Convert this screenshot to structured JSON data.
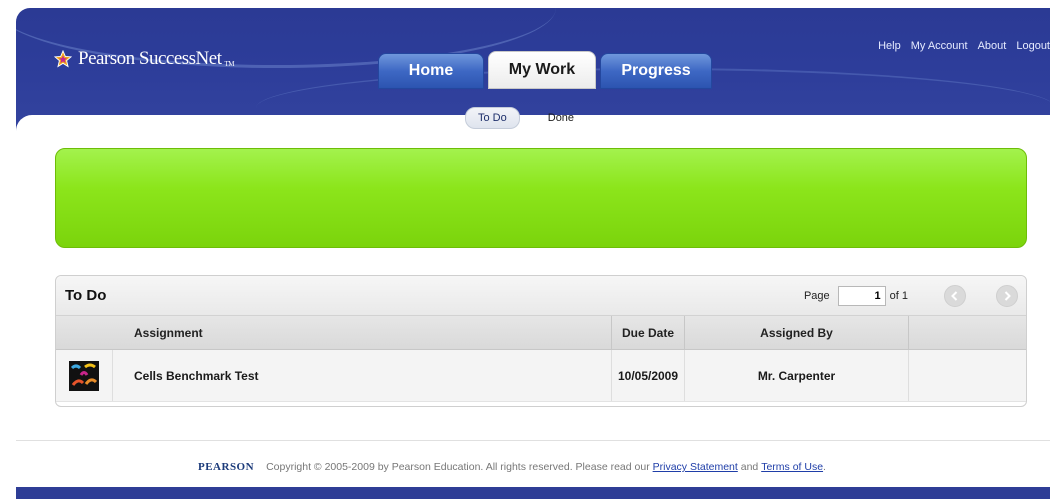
{
  "brand": {
    "name": "Pearson SuccessNet",
    "tm": "TM"
  },
  "top_links": [
    "Help",
    "My Account",
    "About",
    "Logout"
  ],
  "tabs": [
    {
      "label": "Home",
      "active": false
    },
    {
      "label": "My Work",
      "active": true
    },
    {
      "label": "Progress",
      "active": false
    }
  ],
  "subtabs": [
    {
      "label": "To Do",
      "active": true
    },
    {
      "label": "Done",
      "active": false
    }
  ],
  "todo": {
    "title": "To Do",
    "pager": {
      "page_label": "Page",
      "current_page": "1",
      "of_label": "of 1"
    },
    "columns": [
      "Assignment",
      "Due Date",
      "Assigned By"
    ],
    "rows": [
      {
        "icon": "assessment-icon",
        "assignment": "Cells Benchmark Test",
        "due_date": "10/05/2009",
        "assigned_by": "Mr. Carpenter"
      }
    ]
  },
  "footer": {
    "logo": "PEARSON",
    "copyright": "Copyright © 2005-2009 by Pearson Education. All rights reserved. Please read our",
    "privacy": "Privacy Statement",
    "and": "and",
    "terms": "Terms of Use",
    "period": "."
  },
  "colors": {
    "header_bg": "#2d3d9a",
    "tab_blue": "#3e68c4",
    "banner_green": "#8ce51b"
  }
}
